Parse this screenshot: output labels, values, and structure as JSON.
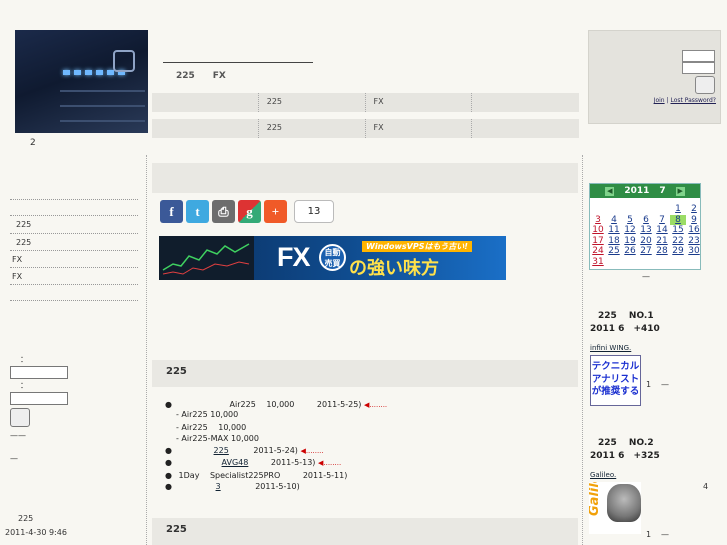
{
  "header": {
    "image_caption": "2",
    "subtitle": "225　　FX"
  },
  "nav_rows": [
    [
      "",
      "225",
      "FX",
      ""
    ],
    [
      "",
      "225",
      "FX",
      ""
    ]
  ],
  "login": {
    "join_label": "Join",
    "separator": "|",
    "lost_password_label": "Lost Password?"
  },
  "left_sidebar": {
    "items": [
      "225",
      "225",
      "FX",
      "FX"
    ],
    "field1_label": "：",
    "field2_label": "：",
    "link_a": "——",
    "link_b": "—",
    "footer_title": "225",
    "footer_datetime": "2011-4-30 9:46"
  },
  "share": {
    "count": "13",
    "icons": [
      "facebook-icon",
      "twitter-icon",
      "print-icon",
      "google-icon",
      "add-icon"
    ]
  },
  "banner": {
    "big_text": "FX",
    "ring_text": "自動 売買",
    "win_text": "WindowsVPSはもう古い!",
    "strong_text": "の強い味方"
  },
  "sections": [
    {
      "title": "225",
      "posts": [
        {
          "bullet": "●",
          "text": "Air225　 10,000",
          "date": "2011-5-25)",
          "mark": "◀........"
        },
        {
          "bullet": "",
          "text": "- Air225 10,000",
          "date": "",
          "mark": ""
        },
        {
          "bullet": "",
          "text": "- Air225　 10,000",
          "date": "",
          "mark": ""
        },
        {
          "bullet": "",
          "text": "- Air225-MAX 10,000",
          "date": "",
          "mark": ""
        },
        {
          "bullet": "●",
          "text": "225",
          "date": "2011-5-24)",
          "mark": "◀........"
        },
        {
          "bullet": "●",
          "text": "AVG48",
          "date": "2011-5-13)",
          "mark": "◀........"
        },
        {
          "bullet": "●",
          "text": "1Day　 Specialist225PRO",
          "date": "2011-5-11)",
          "mark": ""
        },
        {
          "bullet": "●",
          "text": "3",
          "date": "2011-5-10)",
          "mark": ""
        }
      ]
    },
    {
      "title": "225",
      "posts": []
    }
  ],
  "calendar": {
    "year": "2011",
    "month": "7",
    "days": [
      "",
      "",
      "",
      "",
      "",
      "1",
      "2",
      "3",
      "4",
      "5",
      "6",
      "7",
      "8",
      "9",
      "10",
      "11",
      "12",
      "13",
      "14",
      "15",
      "16",
      "17",
      "18",
      "19",
      "20",
      "21",
      "22",
      "23",
      "24",
      "25",
      "26",
      "27",
      "28",
      "29",
      "30",
      "31",
      "",
      "",
      "",
      "",
      "",
      ""
    ],
    "today": "8",
    "footer_mark": "—"
  },
  "right_sidebar": {
    "rank1_title": "225　 NO.1",
    "rank1_sub": "2011  6　+410",
    "rank1_link": "infini WING.",
    "tech_lines": [
      "テクニカル",
      "アナリスト",
      "が推奨する"
    ],
    "tech_rank": "1",
    "tech_dash": "—",
    "rank2_title": "225　 NO.2",
    "rank2_sub": "2011  6　+325",
    "rank2_link": "Galileo.",
    "galileo_word": "Galileo",
    "galileo_rank": "1",
    "galileo_dash": "—",
    "side_number": "4"
  }
}
